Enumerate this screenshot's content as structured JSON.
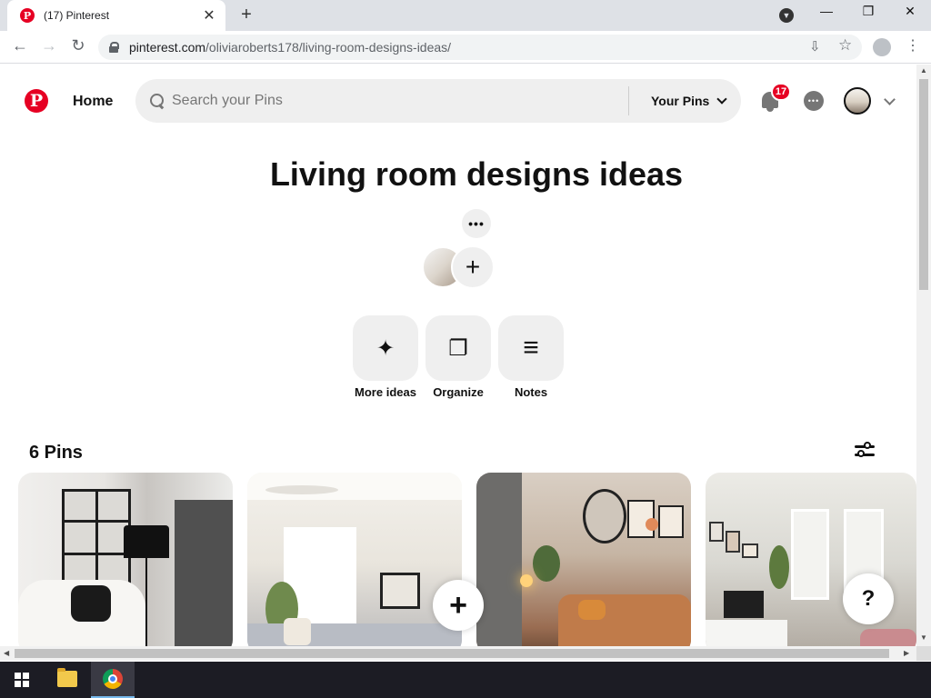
{
  "browser": {
    "tab_title": "(17) Pinterest",
    "tab_close": "✕",
    "new_tab": "+",
    "url_host": "pinterest.com",
    "url_path": "/oliviaroberts178/living-room-designs-ideas/",
    "back": "←",
    "forward": "→",
    "reload": "↻",
    "minimize": "—",
    "maximize": "❐",
    "close": "✕",
    "menu": "⋮",
    "install_icon": "⇩",
    "bookmark_icon": "☆"
  },
  "header": {
    "logo": "P",
    "home_label": "Home",
    "search_placeholder": "Search your Pins",
    "your_pins_label": "Your Pins",
    "notification_count": "17"
  },
  "board": {
    "title": "Living room designs ideas",
    "more_label": "•••",
    "add_collaborator": "+",
    "actions": [
      {
        "label": "More ideas",
        "icon": "sparkle-icon",
        "glyph": "✦"
      },
      {
        "label": "Organize",
        "icon": "organize-icon",
        "glyph": "❐"
      },
      {
        "label": "Notes",
        "icon": "notes-icon",
        "glyph": "≡"
      }
    ],
    "pins_count": "6 Pins"
  },
  "pins": [
    {
      "name": "pin-white-armchair-room"
    },
    {
      "name": "pin-bright-living-room"
    },
    {
      "name": "pin-cozy-bedroom-boho"
    },
    {
      "name": "pin-gallery-wall-room"
    }
  ],
  "floating": {
    "add_pin": "+",
    "help": "?"
  },
  "colors": {
    "brand": "#e60023",
    "text": "#111111",
    "muted": "#767676",
    "surface": "#efefef"
  }
}
